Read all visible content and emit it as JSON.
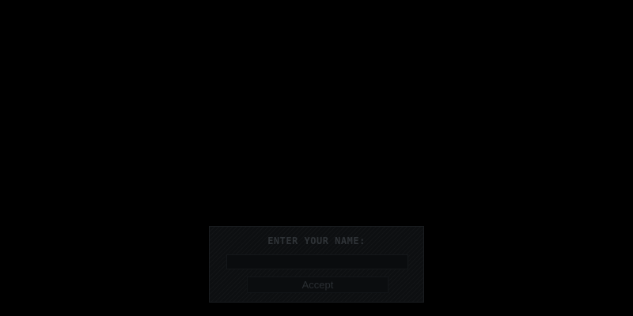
{
  "dialog": {
    "title": "ENTER YOUR NAME:",
    "name_input": {
      "value": "",
      "placeholder": ""
    },
    "accept_label": "Accept"
  },
  "colors": {
    "background": "#000000",
    "panel": "#0d0f11",
    "title_text": "#2f3337",
    "button_text": "#2a2e32"
  }
}
